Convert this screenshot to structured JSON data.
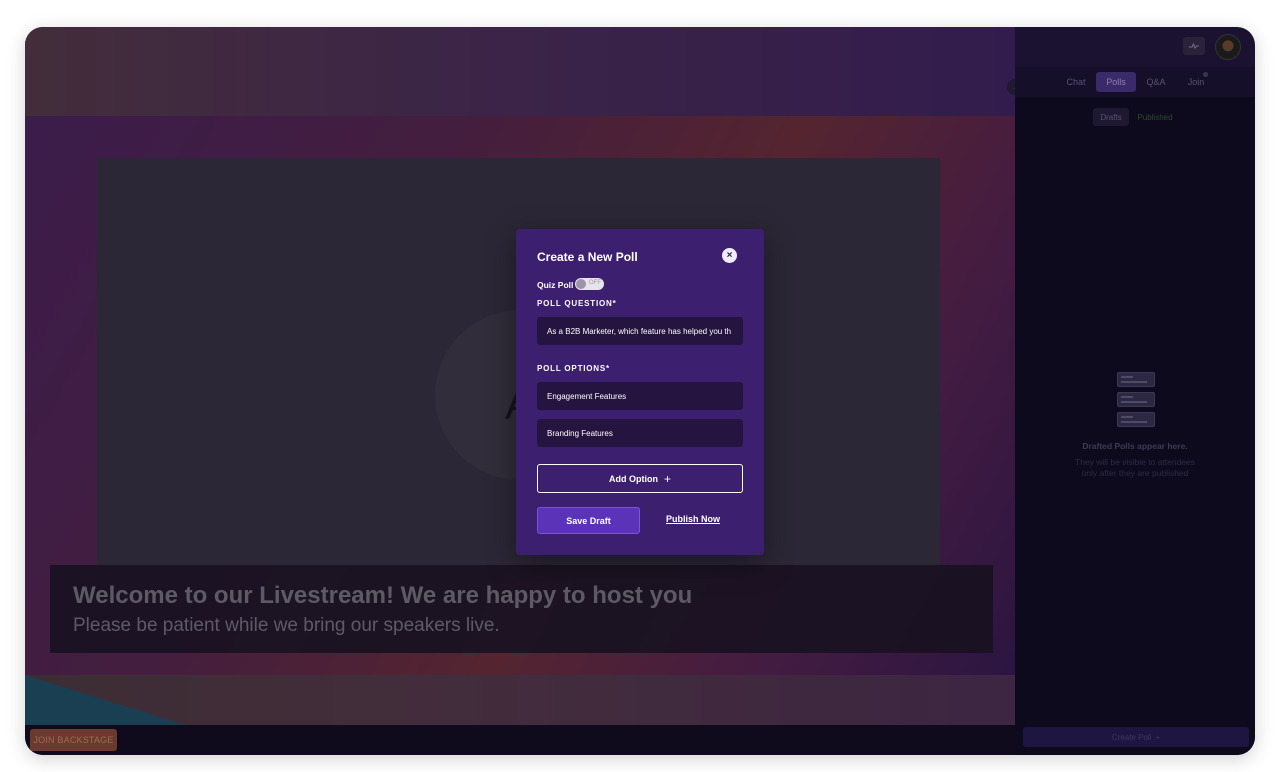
{
  "stage": {
    "slide_letter": "A",
    "banner_title": "Welcome to our Livestream! We are happy to host you",
    "banner_subtitle": "Please be patient while we bring our speakers live.",
    "join_backstage_label": "JOIN BACKSTAGE"
  },
  "header": {
    "icon_button": "signal-icon"
  },
  "sidebar": {
    "tabs": [
      {
        "label": "Chat",
        "active": false
      },
      {
        "label": "Polls",
        "active": true
      },
      {
        "label": "Q&A",
        "active": false
      },
      {
        "label": "Join",
        "active": false
      }
    ],
    "subtabs": [
      {
        "label": "Drafts",
        "active": true
      },
      {
        "label": "Published",
        "active": false
      }
    ],
    "empty_title": "Drafted Polls appear here.",
    "empty_subtitle": "They will be visible to attendees only after they are published",
    "create_poll_label": "Create Poll",
    "create_poll_icon": "+"
  },
  "modal": {
    "title": "Create a New Poll",
    "close_icon": "×",
    "quiz_label": "Quiz Poll",
    "quiz_toggle_text": "OFF",
    "question_label": "POLL QUESTION*",
    "question_value": "As a B2B Marketer, which feature has helped you th",
    "options_label": "POLL OPTIONS*",
    "options": [
      "Engagement Features",
      "Branding Features"
    ],
    "add_option_label": "Add Option",
    "add_option_icon": "+",
    "save_draft_label": "Save Draft",
    "publish_now_label": "Publish Now"
  },
  "colors": {
    "modal_bg": "#3d1f70",
    "input_bg": "#25143f",
    "primary_button": "#5b33b8"
  }
}
